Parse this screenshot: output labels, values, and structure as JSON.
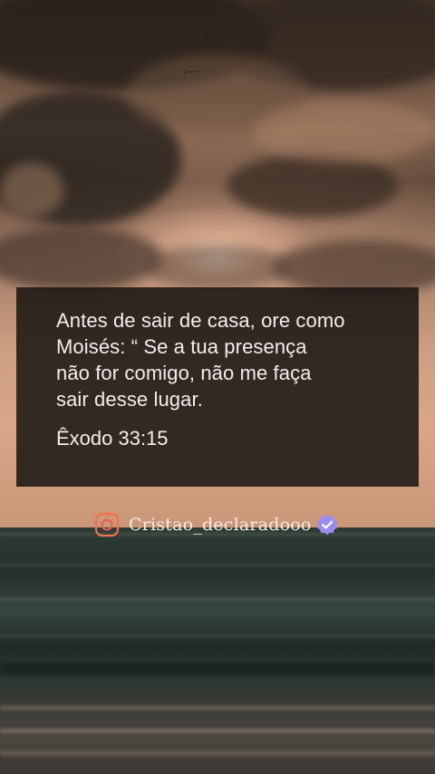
{
  "quote": {
    "lines": [
      "Antes de sair de casa, ore como",
      "Moisés: “ Se a tua presença",
      "não for comigo, não me faça",
      "sair desse lugar."
    ],
    "reference": "Êxodo 33:15"
  },
  "credit": {
    "icon": "instagram-icon",
    "handle": "Cristao_declaradooo",
    "badge_icon": "verified-badge-icon",
    "badge_color": "#9b8cf0",
    "icon_color": "#f0734a"
  }
}
